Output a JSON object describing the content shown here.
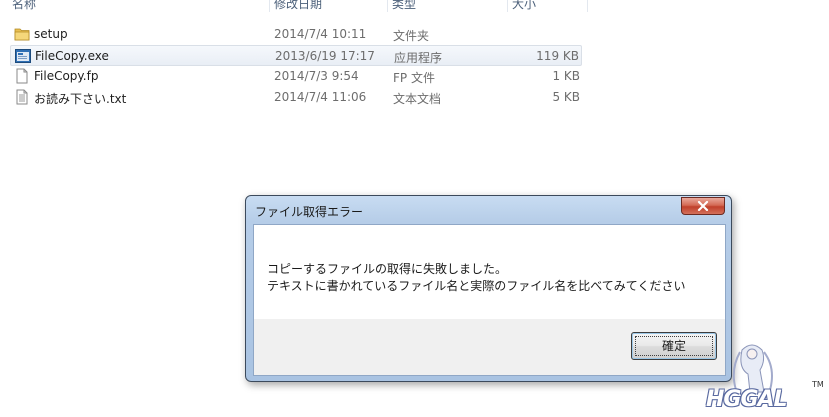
{
  "explorer": {
    "columns": {
      "name": "名称",
      "date": "修改日期",
      "type": "类型",
      "size": "大小"
    },
    "files": [
      {
        "name": "setup",
        "date": "2014/7/4 10:11",
        "type": "文件夹",
        "size": "",
        "icon": "folder-icon"
      },
      {
        "name": "FileCopy.exe",
        "date": "2013/6/19 17:17",
        "type": "应用程序",
        "size": "119 KB",
        "icon": "exe-icon",
        "selected": true
      },
      {
        "name": "FileCopy.fp",
        "date": "2014/7/3 9:54",
        "type": "FP 文件",
        "size": "1 KB",
        "icon": "file-icon"
      },
      {
        "name": "お読み下さい.txt",
        "date": "2014/7/4 11:06",
        "type": "文本文档",
        "size": "5 KB",
        "icon": "text-file-icon"
      }
    ]
  },
  "dialog": {
    "title": "ファイル取得エラー",
    "message_line1": "コピーするファイルの取得に失敗しました。",
    "message_line2": "テキストに書かれているファイル名と実際のファイル名を比べてみてください",
    "ok_label": "確定"
  },
  "watermark": {
    "text": "HGGAL",
    "tm": "TM"
  },
  "colors": {
    "header_text": "#4c607a",
    "detail_text": "#6d6d6d",
    "dialog_frame": "#b6cde8",
    "close_button": "#c0402b"
  }
}
